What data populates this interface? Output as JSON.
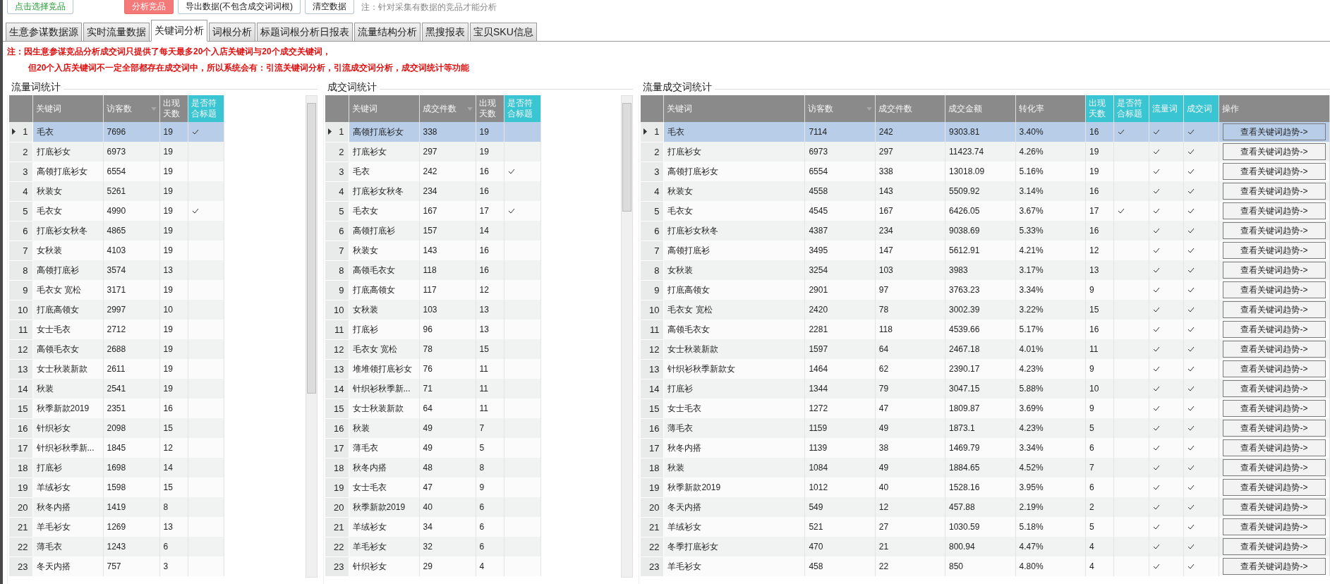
{
  "toolbar": {
    "buttons": [
      {
        "label": "点击选择竞品",
        "kind": "select"
      },
      {
        "label": "分析竞品",
        "kind": "primary"
      },
      {
        "label": "导出数据(不包含成交词词根)",
        "kind": "plain"
      },
      {
        "label": "清空数据",
        "kind": "plain"
      }
    ],
    "note": "注：针对采集有数据的竞品才能分析"
  },
  "tabs": [
    {
      "label": "生意参谋数据源",
      "selected": false
    },
    {
      "label": "实时流量数据",
      "selected": false
    },
    {
      "label": "关键词分析",
      "selected": true
    },
    {
      "label": "词根分析",
      "selected": false
    },
    {
      "label": "标题词根分析日报表",
      "selected": false
    },
    {
      "label": "流量结构分析",
      "selected": false
    },
    {
      "label": "黑搜报表",
      "selected": false
    },
    {
      "label": "宝贝SKU信息",
      "selected": false
    }
  ],
  "notice": [
    "注：因生意参谋竞品分析成交词只提供了每天最多20个入店关键词与20个成交关键词，",
    "但20个入店关键词不一定全部都存在成交词中，所以系统会有：引流关键词分析，引流成交词分析，成交词统计等功能"
  ],
  "panels": [
    {
      "title": "流量词统计",
      "scrollbar": true,
      "columns": [
        {
          "label": "关键词",
          "kind": "text",
          "accent": false,
          "sorted": false
        },
        {
          "label": "访客数",
          "kind": "text",
          "accent": false,
          "sorted": true
        },
        {
          "label": "出现天数",
          "kind": "text",
          "accent": false,
          "sorted": false
        },
        {
          "label": "是否符合标题",
          "kind": "check",
          "accent": true,
          "sorted": false
        }
      ],
      "rows": [
        {
          "no": "1",
          "selected": true,
          "cells": [
            "毛衣",
            "7696",
            "19",
            true
          ]
        },
        {
          "no": "2",
          "selected": false,
          "cells": [
            "打底衫女",
            "6973",
            "19",
            false
          ]
        },
        {
          "no": "3",
          "selected": false,
          "cells": [
            "高领打底衫女",
            "6554",
            "19",
            false
          ]
        },
        {
          "no": "4",
          "selected": false,
          "cells": [
            "秋装女",
            "5261",
            "19",
            false
          ]
        },
        {
          "no": "5",
          "selected": false,
          "cells": [
            "毛衣女",
            "4990",
            "19",
            true
          ]
        },
        {
          "no": "6",
          "selected": false,
          "cells": [
            "打底衫女秋冬",
            "4865",
            "19",
            false
          ]
        },
        {
          "no": "7",
          "selected": false,
          "cells": [
            "女秋装",
            "4103",
            "19",
            false
          ]
        },
        {
          "no": "8",
          "selected": false,
          "cells": [
            "高领打底衫",
            "3574",
            "13",
            false
          ]
        },
        {
          "no": "9",
          "selected": false,
          "cells": [
            "毛衣女 宽松",
            "3171",
            "19",
            false
          ]
        },
        {
          "no": "10",
          "selected": false,
          "cells": [
            "打底高领女",
            "2997",
            "10",
            false
          ]
        },
        {
          "no": "11",
          "selected": false,
          "cells": [
            "女士毛衣",
            "2712",
            "19",
            false
          ]
        },
        {
          "no": "12",
          "selected": false,
          "cells": [
            "高领毛衣女",
            "2688",
            "19",
            false
          ]
        },
        {
          "no": "13",
          "selected": false,
          "cells": [
            "女士秋装新款",
            "2611",
            "19",
            false
          ]
        },
        {
          "no": "14",
          "selected": false,
          "cells": [
            "秋装",
            "2541",
            "19",
            false
          ]
        },
        {
          "no": "15",
          "selected": false,
          "cells": [
            "秋季新款2019",
            "2351",
            "16",
            false
          ]
        },
        {
          "no": "16",
          "selected": false,
          "cells": [
            "针织衫女",
            "2098",
            "15",
            false
          ]
        },
        {
          "no": "17",
          "selected": false,
          "cells": [
            "针织衫秋季新...",
            "1845",
            "12",
            false
          ]
        },
        {
          "no": "18",
          "selected": false,
          "cells": [
            "打底衫",
            "1698",
            "14",
            false
          ]
        },
        {
          "no": "19",
          "selected": false,
          "cells": [
            "羊绒衫女",
            "1598",
            "15",
            false
          ]
        },
        {
          "no": "20",
          "selected": false,
          "cells": [
            "秋冬内搭",
            "1419",
            "8",
            false
          ]
        },
        {
          "no": "21",
          "selected": false,
          "cells": [
            "羊毛衫女",
            "1269",
            "13",
            false
          ]
        },
        {
          "no": "22",
          "selected": false,
          "cells": [
            "薄毛衣",
            "1243",
            "6",
            false
          ]
        },
        {
          "no": "23",
          "selected": false,
          "cells": [
            "冬天内搭",
            "757",
            "3",
            false
          ]
        }
      ]
    },
    {
      "title": "成交词统计",
      "scrollbar": true,
      "columns": [
        {
          "label": "关键词",
          "kind": "text",
          "accent": false,
          "sorted": false
        },
        {
          "label": "成交件数",
          "kind": "text",
          "accent": false,
          "sorted": true
        },
        {
          "label": "出现天数",
          "kind": "text",
          "accent": false,
          "sorted": false
        },
        {
          "label": "是否符合标题",
          "kind": "check",
          "accent": true,
          "sorted": false
        }
      ],
      "rows": [
        {
          "no": "1",
          "selected": true,
          "cells": [
            "高领打底衫女",
            "338",
            "19",
            false
          ]
        },
        {
          "no": "2",
          "selected": false,
          "cells": [
            "打底衫女",
            "297",
            "19",
            false
          ]
        },
        {
          "no": "3",
          "selected": false,
          "cells": [
            "毛衣",
            "242",
            "16",
            true
          ]
        },
        {
          "no": "4",
          "selected": false,
          "cells": [
            "打底衫女秋冬",
            "234",
            "16",
            false
          ]
        },
        {
          "no": "5",
          "selected": false,
          "cells": [
            "毛衣女",
            "167",
            "17",
            true
          ]
        },
        {
          "no": "6",
          "selected": false,
          "cells": [
            "高领打底衫",
            "157",
            "14",
            false
          ]
        },
        {
          "no": "7",
          "selected": false,
          "cells": [
            "秋装女",
            "143",
            "16",
            false
          ]
        },
        {
          "no": "8",
          "selected": false,
          "cells": [
            "高领毛衣女",
            "118",
            "16",
            false
          ]
        },
        {
          "no": "9",
          "selected": false,
          "cells": [
            "打底高领女",
            "117",
            "12",
            false
          ]
        },
        {
          "no": "10",
          "selected": false,
          "cells": [
            "女秋装",
            "103",
            "13",
            false
          ]
        },
        {
          "no": "11",
          "selected": false,
          "cells": [
            "打底衫",
            "96",
            "13",
            false
          ]
        },
        {
          "no": "12",
          "selected": false,
          "cells": [
            "毛衣女 宽松",
            "78",
            "15",
            false
          ]
        },
        {
          "no": "13",
          "selected": false,
          "cells": [
            "堆堆领打底衫女",
            "76",
            "11",
            false
          ]
        },
        {
          "no": "14",
          "selected": false,
          "cells": [
            "针织衫秋季新...",
            "71",
            "11",
            false
          ]
        },
        {
          "no": "15",
          "selected": false,
          "cells": [
            "女士秋装新款",
            "64",
            "11",
            false
          ]
        },
        {
          "no": "16",
          "selected": false,
          "cells": [
            "秋装",
            "49",
            "7",
            false
          ]
        },
        {
          "no": "17",
          "selected": false,
          "cells": [
            "薄毛衣",
            "49",
            "5",
            false
          ]
        },
        {
          "no": "18",
          "selected": false,
          "cells": [
            "秋冬内搭",
            "48",
            "8",
            false
          ]
        },
        {
          "no": "19",
          "selected": false,
          "cells": [
            "女士毛衣",
            "47",
            "9",
            false
          ]
        },
        {
          "no": "20",
          "selected": false,
          "cells": [
            "秋季新款2019",
            "40",
            "6",
            false
          ]
        },
        {
          "no": "21",
          "selected": false,
          "cells": [
            "羊绒衫女",
            "34",
            "6",
            false
          ]
        },
        {
          "no": "22",
          "selected": false,
          "cells": [
            "羊毛衫女",
            "32",
            "6",
            false
          ]
        },
        {
          "no": "23",
          "selected": false,
          "cells": [
            "针织衫女",
            "29",
            "4",
            false
          ]
        }
      ]
    },
    {
      "title": "流量成交词统计",
      "scrollbar": false,
      "columns": [
        {
          "label": "关键词",
          "kind": "text",
          "accent": false,
          "sorted": false
        },
        {
          "label": "访客数",
          "kind": "text",
          "accent": false,
          "sorted": true
        },
        {
          "label": "成交件数",
          "kind": "text",
          "accent": false,
          "sorted": false
        },
        {
          "label": "成交金额",
          "kind": "text",
          "accent": false,
          "sorted": false
        },
        {
          "label": "转化率",
          "kind": "text",
          "accent": false,
          "sorted": false
        },
        {
          "label": "出现天数",
          "kind": "text",
          "accent": true,
          "sorted": false
        },
        {
          "label": "是否符合标题",
          "kind": "check",
          "accent": true,
          "sorted": false
        },
        {
          "label": "流量词",
          "kind": "check",
          "accent": true,
          "sorted": false
        },
        {
          "label": "成交词",
          "kind": "check",
          "accent": true,
          "sorted": false
        },
        {
          "label": "操作",
          "kind": "button",
          "accent": false,
          "sorted": false
        }
      ],
      "rows": [
        {
          "no": "1",
          "selected": true,
          "cells": [
            "毛衣",
            "7114",
            "242",
            "9303.81",
            "3.40%",
            "16",
            true,
            true,
            true,
            "查看关键词趋势->"
          ]
        },
        {
          "no": "2",
          "selected": false,
          "cells": [
            "打底衫女",
            "6973",
            "297",
            "11423.74",
            "4.26%",
            "19",
            false,
            true,
            true,
            "查看关键词趋势->"
          ]
        },
        {
          "no": "3",
          "selected": false,
          "cells": [
            "高领打底衫女",
            "6554",
            "338",
            "13018.09",
            "5.16%",
            "19",
            false,
            true,
            true,
            "查看关键词趋势->"
          ]
        },
        {
          "no": "4",
          "selected": false,
          "cells": [
            "秋装女",
            "4558",
            "143",
            "5509.92",
            "3.14%",
            "16",
            false,
            true,
            true,
            "查看关键词趋势->"
          ]
        },
        {
          "no": "5",
          "selected": false,
          "cells": [
            "毛衣女",
            "4545",
            "167",
            "6426.05",
            "3.67%",
            "17",
            true,
            true,
            true,
            "查看关键词趋势->"
          ]
        },
        {
          "no": "6",
          "selected": false,
          "cells": [
            "打底衫女秋冬",
            "4387",
            "234",
            "9038.69",
            "5.33%",
            "16",
            false,
            true,
            true,
            "查看关键词趋势->"
          ]
        },
        {
          "no": "7",
          "selected": false,
          "cells": [
            "高领打底衫",
            "3495",
            "147",
            "5612.91",
            "4.21%",
            "12",
            false,
            true,
            true,
            "查看关键词趋势->"
          ]
        },
        {
          "no": "8",
          "selected": false,
          "cells": [
            "女秋装",
            "3254",
            "103",
            "3983",
            "3.17%",
            "13",
            false,
            true,
            true,
            "查看关键词趋势->"
          ]
        },
        {
          "no": "9",
          "selected": false,
          "cells": [
            "打底高领女",
            "2901",
            "97",
            "3763.23",
            "3.34%",
            "9",
            false,
            true,
            true,
            "查看关键词趋势->"
          ]
        },
        {
          "no": "10",
          "selected": false,
          "cells": [
            "毛衣女 宽松",
            "2420",
            "78",
            "3002.39",
            "3.22%",
            "15",
            false,
            true,
            true,
            "查看关键词趋势->"
          ]
        },
        {
          "no": "11",
          "selected": false,
          "cells": [
            "高领毛衣女",
            "2281",
            "118",
            "4539.66",
            "5.17%",
            "16",
            false,
            true,
            true,
            "查看关键词趋势->"
          ]
        },
        {
          "no": "12",
          "selected": false,
          "cells": [
            "女士秋装新款",
            "1597",
            "64",
            "2467.18",
            "4.01%",
            "11",
            false,
            true,
            true,
            "查看关键词趋势->"
          ]
        },
        {
          "no": "13",
          "selected": false,
          "cells": [
            "针织衫秋季新款女",
            "1464",
            "62",
            "2390.17",
            "4.23%",
            "9",
            false,
            true,
            true,
            "查看关键词趋势->"
          ]
        },
        {
          "no": "14",
          "selected": false,
          "cells": [
            "打底衫",
            "1344",
            "79",
            "3047.15",
            "5.88%",
            "10",
            false,
            true,
            true,
            "查看关键词趋势->"
          ]
        },
        {
          "no": "15",
          "selected": false,
          "cells": [
            "女士毛衣",
            "1272",
            "47",
            "1809.87",
            "3.69%",
            "9",
            false,
            true,
            true,
            "查看关键词趋势->"
          ]
        },
        {
          "no": "16",
          "selected": false,
          "cells": [
            "薄毛衣",
            "1159",
            "49",
            "1873.1",
            "4.23%",
            "5",
            false,
            true,
            true,
            "查看关键词趋势->"
          ]
        },
        {
          "no": "17",
          "selected": false,
          "cells": [
            "秋冬内搭",
            "1139",
            "38",
            "1469.79",
            "3.34%",
            "6",
            false,
            true,
            true,
            "查看关键词趋势->"
          ]
        },
        {
          "no": "18",
          "selected": false,
          "cells": [
            "秋装",
            "1084",
            "49",
            "1884.65",
            "4.52%",
            "7",
            false,
            true,
            true,
            "查看关键词趋势->"
          ]
        },
        {
          "no": "19",
          "selected": false,
          "cells": [
            "秋季新款2019",
            "1012",
            "40",
            "1528.16",
            "3.95%",
            "6",
            false,
            true,
            true,
            "查看关键词趋势->"
          ]
        },
        {
          "no": "20",
          "selected": false,
          "cells": [
            "冬天内搭",
            "549",
            "12",
            "457.88",
            "2.19%",
            "2",
            false,
            true,
            true,
            "查看关键词趋势->"
          ]
        },
        {
          "no": "21",
          "selected": false,
          "cells": [
            "羊绒衫女",
            "521",
            "27",
            "1030.59",
            "5.18%",
            "5",
            false,
            true,
            true,
            "查看关键词趋势->"
          ]
        },
        {
          "no": "22",
          "selected": false,
          "cells": [
            "冬季打底衫女",
            "470",
            "21",
            "800.94",
            "4.47%",
            "4",
            false,
            true,
            true,
            "查看关键词趋势->"
          ]
        },
        {
          "no": "23",
          "selected": false,
          "cells": [
            "羊毛衫女",
            "458",
            "22",
            "850",
            "4.80%",
            "4",
            false,
            true,
            true,
            "查看关键词趋势->"
          ]
        }
      ]
    }
  ]
}
